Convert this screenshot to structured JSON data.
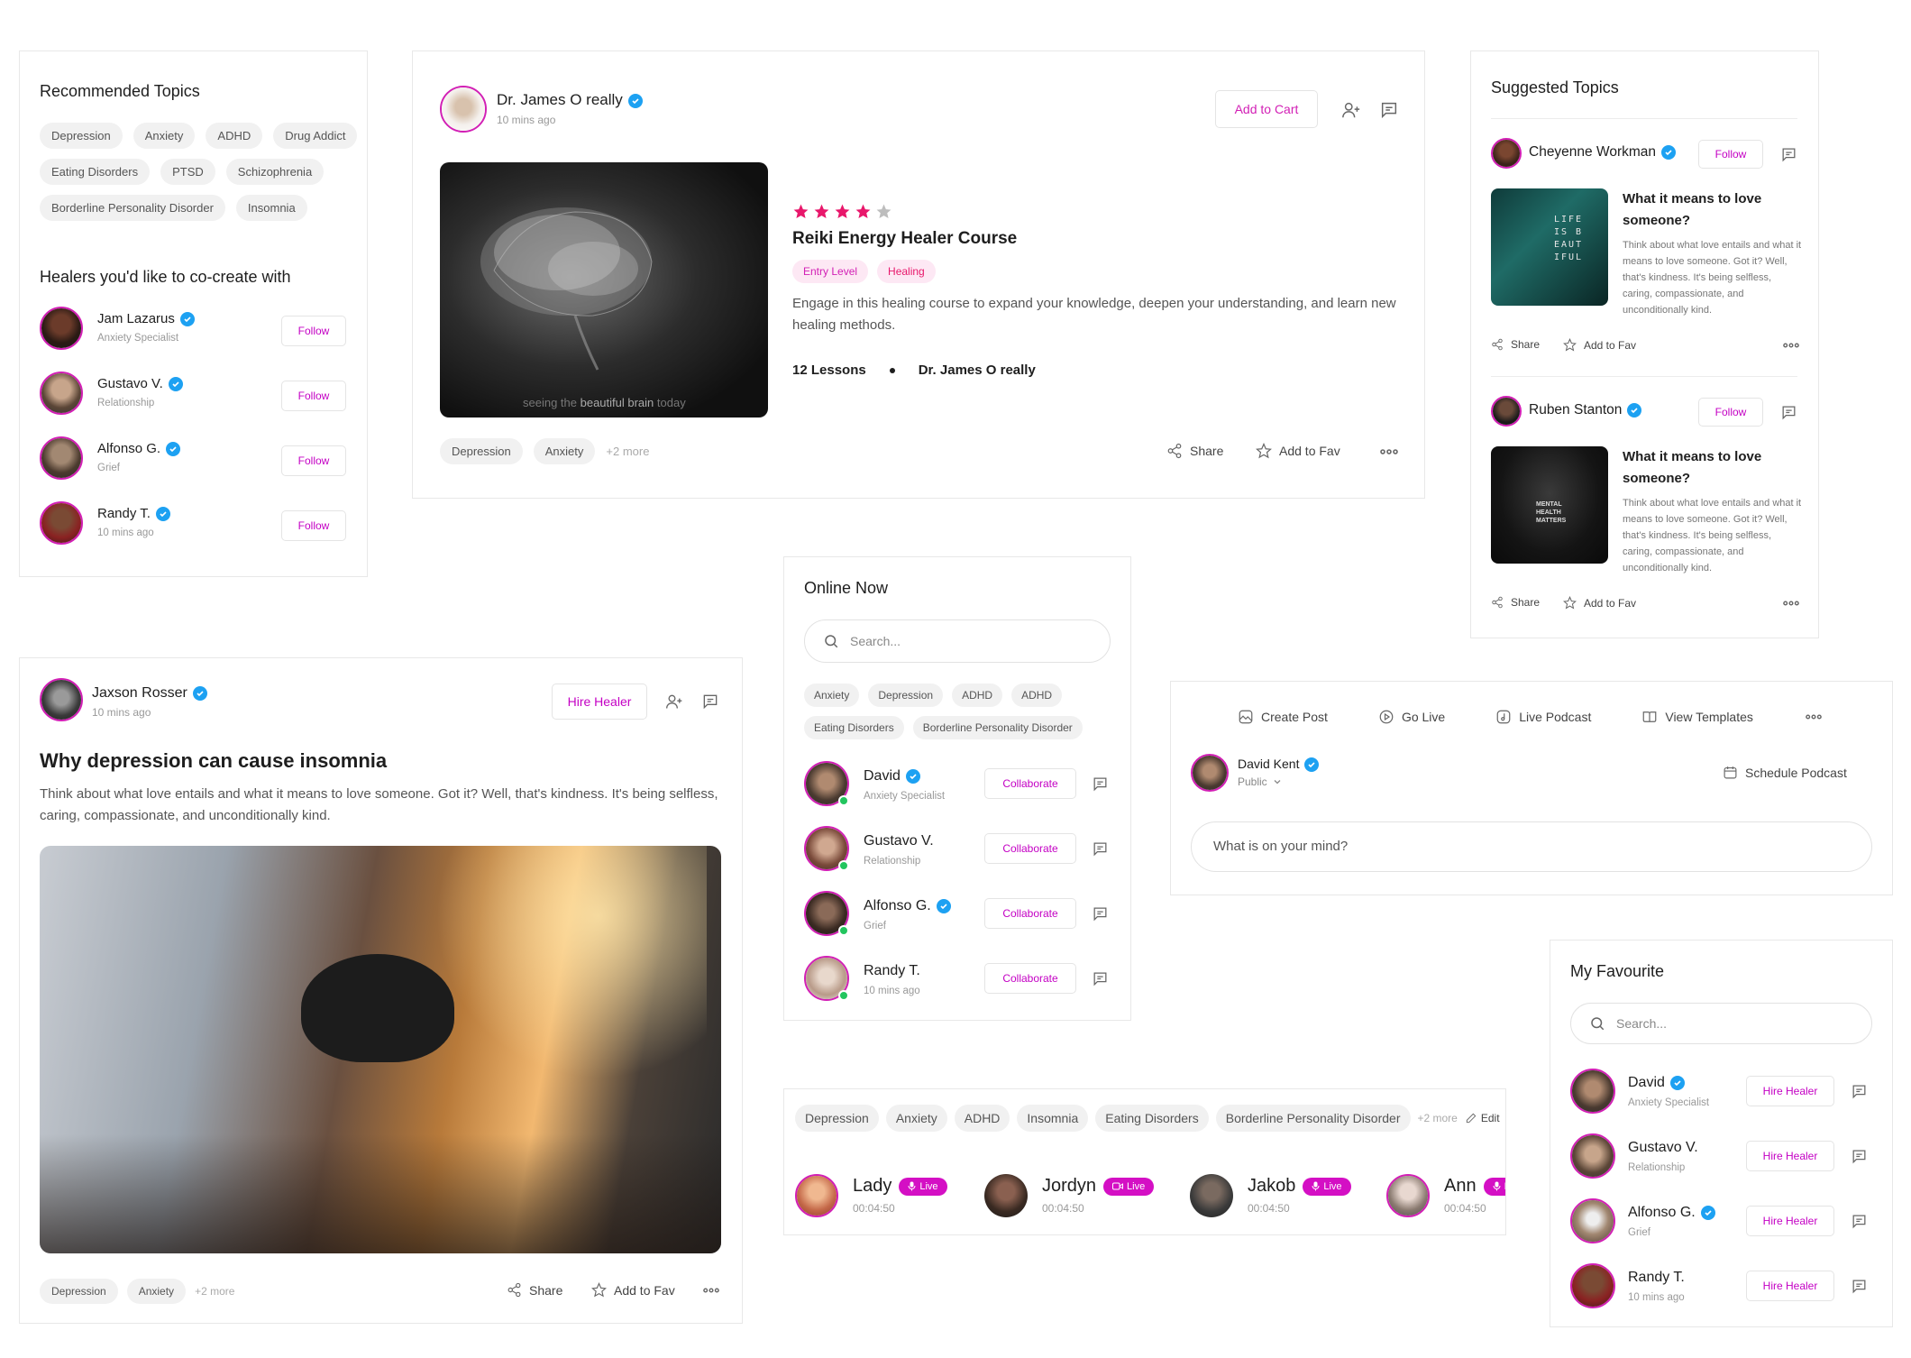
{
  "recommended": {
    "title": "Recommended Topics",
    "topics": [
      "Depression",
      "Anxiety",
      "ADHD",
      "Drug Addict",
      "Eating Disorders",
      "PTSD",
      "Schizophrenia",
      "Borderline Personality Disorder",
      "Insomnia"
    ],
    "healers_title": "Healers you'd like to co-create with",
    "healers": [
      {
        "name": "Jam Lazarus",
        "sub": "Anxiety Specialist",
        "action": "Follow"
      },
      {
        "name": "Gustavo V.",
        "sub": "Relationship",
        "action": "Follow"
      },
      {
        "name": "Alfonso G.",
        "sub": "Grief",
        "action": "Follow"
      },
      {
        "name": "Randy T.",
        "sub": "10 mins ago",
        "action": "Follow"
      }
    ]
  },
  "course_post": {
    "author": "Dr. James O really",
    "time": "10 mins ago",
    "add_to_cart": "Add to Cart",
    "image_caption_a": "seeing the ",
    "image_caption_b": "beautiful brain",
    "image_caption_c": " today",
    "rating": 4,
    "rating_max": 5,
    "title": "Reiki Energy Healer Course",
    "tags": [
      "Entry Level",
      "Healing"
    ],
    "description": "Engage in this healing course to expand your knowledge, deepen your understanding, and learn new healing methods.",
    "lessons": "12 Lessons",
    "instructor": "Dr. James O really",
    "chips": [
      "Depression",
      "Anxiety"
    ],
    "more": "+2 more",
    "share": "Share",
    "fav": "Add to Fav"
  },
  "suggested": {
    "title": "Suggested Topics",
    "items": [
      {
        "name": "Cheyenne Workman",
        "follow": "Follow",
        "headline": "What it means to love someone?",
        "body": "Think about what love entails and what it means to love someone. Got it? Well, that's kindness. It's being selfless, caring, compassionate, and unconditionally kind.",
        "image_text": "LIFE IS BEAUTIFUL",
        "share": "Share",
        "fav": "Add to Fav"
      },
      {
        "name": "Ruben Stanton",
        "follow": "Follow",
        "headline": "What it means to love someone?",
        "body": "Think about what love entails and what it means to love someone. Got it? Well, that's kindness. It's being selfless, caring, compassionate, and unconditionally kind.",
        "image_text": "MENTAL HEALTH MATTERS",
        "share": "Share",
        "fav": "Add to Fav"
      }
    ]
  },
  "online_now": {
    "title": "Online Now",
    "search_placeholder": "Search...",
    "chips": [
      "Anxiety",
      "Depression",
      "ADHD",
      "ADHD",
      "Eating Disorders",
      "Borderline Personality Disorder"
    ],
    "people": [
      {
        "name": "David",
        "sub": "Anxiety Specialist",
        "verified": true,
        "action": "Collaborate"
      },
      {
        "name": "Gustavo V.",
        "sub": "Relationship",
        "verified": false,
        "action": "Collaborate"
      },
      {
        "name": "Alfonso G.",
        "sub": "Grief",
        "verified": true,
        "action": "Collaborate"
      },
      {
        "name": "Randy T.",
        "sub": "10 mins ago",
        "verified": false,
        "action": "Collaborate"
      }
    ]
  },
  "article_post": {
    "author": "Jaxson Rosser",
    "time": "10 mins ago",
    "hire": "Hire Healer",
    "title": "Why depression can cause insomnia",
    "body": "Think about what love entails and what it means to love someone. Got it? Well, that's kindness. It's being selfless, caring, compassionate, and unconditionally kind.",
    "chips": [
      "Depression",
      "Anxiety"
    ],
    "more": "+2 more",
    "share": "Share",
    "fav": "Add to Fav"
  },
  "composer": {
    "tabs": [
      "Create Post",
      "Go Live",
      "Live Podcast",
      "View Templates"
    ],
    "user": "David Kent",
    "visibility": "Public",
    "schedule": "Schedule Podcast",
    "placeholder": "What is on your mind?"
  },
  "live_strip": {
    "chips": [
      "Depression",
      "Anxiety",
      "ADHD",
      "Insomnia",
      "Eating Disorders",
      "Borderline Personality Disorder"
    ],
    "more": "+2 more",
    "edit": "Edit",
    "live_label": "Live",
    "streams": [
      {
        "name": "Lady",
        "time": "00:04:50"
      },
      {
        "name": "Jordyn",
        "time": "00:04:50"
      },
      {
        "name": "Jakob",
        "time": "00:04:50"
      },
      {
        "name": "Ann",
        "time": "00:04:50"
      }
    ]
  },
  "favourite": {
    "title": "My Favourite",
    "search_placeholder": "Search...",
    "people": [
      {
        "name": "David",
        "sub": "Anxiety Specialist",
        "verified": true,
        "action": "Hire Healer"
      },
      {
        "name": "Gustavo V.",
        "sub": "Relationship",
        "verified": false,
        "action": "Hire Healer"
      },
      {
        "name": "Alfonso G.",
        "sub": "Grief",
        "verified": true,
        "action": "Hire Healer"
      },
      {
        "name": "Randy T.",
        "sub": "10 mins ago",
        "verified": false,
        "action": "Hire Healer"
      }
    ]
  },
  "colors": {
    "accent": "#d21fb5",
    "live": "#d40fc4",
    "verified": "#1da1f2",
    "star": "#e8176b"
  }
}
